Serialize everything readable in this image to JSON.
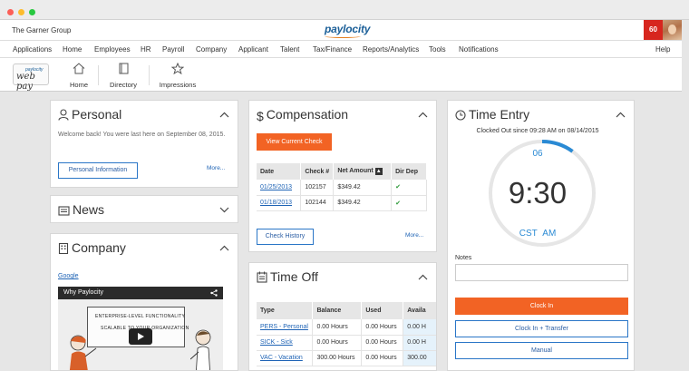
{
  "header": {
    "company_name": "The Garner Group",
    "brand": "paylocity",
    "notification_count": "60"
  },
  "menu": [
    "Applications",
    "Home",
    "Employees",
    "HR",
    "Payroll",
    "Company",
    "Applicant",
    "Talent",
    "Tax/Finance",
    "Reports/Analytics",
    "Tools",
    "Notifications"
  ],
  "help_label": "Help",
  "toolbar": {
    "logo_small": "paylocity",
    "logo_big": "web pay",
    "items": [
      {
        "label": "Home",
        "icon": "home-icon"
      },
      {
        "label": "Directory",
        "icon": "book-icon"
      },
      {
        "label": "Impressions",
        "icon": "star-icon"
      }
    ]
  },
  "personal": {
    "title": "Personal",
    "welcome": "Welcome back! You were last here on September 08, 2015.",
    "button": "Personal Information",
    "more": "More..."
  },
  "news": {
    "title": "News"
  },
  "company": {
    "title": "Company",
    "link": "Google",
    "video_title": "Why Paylocity",
    "board_line1": "ENTERPRISE-LEVEL FUNCTIONALITY",
    "board_line2": "SCALABLE TO YOUR ORGANIZATION"
  },
  "compensation": {
    "title": "Compensation",
    "button": "View Current Check",
    "columns": [
      "Date",
      "Check #",
      "Net Amount",
      "Dir Dep"
    ],
    "rows": [
      {
        "date": "01/25/2013",
        "check": "102157",
        "amount": "$349.42",
        "dirdep": "✔"
      },
      {
        "date": "01/18/2013",
        "check": "102144",
        "amount": "$349.42",
        "dirdep": "✔"
      }
    ],
    "history_button": "Check History",
    "more": "More..."
  },
  "timeoff": {
    "title": "Time Off",
    "columns": [
      "Type",
      "Balance",
      "Used",
      "Availa"
    ],
    "rows": [
      {
        "type": "PERS - Personal",
        "balance": "0.00 Hours",
        "used": "0.00 Hours",
        "avail": "0.00 H"
      },
      {
        "type": "SICK - Sick",
        "balance": "0.00 Hours",
        "used": "0.00 Hours",
        "avail": "0.00 H"
      },
      {
        "type": "VAC - Vacation",
        "balance": "300.00 Hours",
        "used": "0.00 Hours",
        "avail": "300.00"
      }
    ]
  },
  "time_entry": {
    "title": "Time Entry",
    "status": "Clocked Out since 09:28 AM on 08/14/2015",
    "seconds": "06",
    "time": "9:30",
    "timezone": "CST",
    "ampm": "AM",
    "seconds_progress_fraction": 0.1,
    "notes_label": "Notes",
    "notes_value": "",
    "clock_in": "Clock In",
    "clock_in_transfer": "Clock In + Transfer",
    "manual": "Manual"
  },
  "colors": {
    "accent_orange": "#f26324",
    "link_blue": "#1e63b5",
    "clock_blue": "#2a8ad4",
    "badge_red": "#d7261e"
  }
}
